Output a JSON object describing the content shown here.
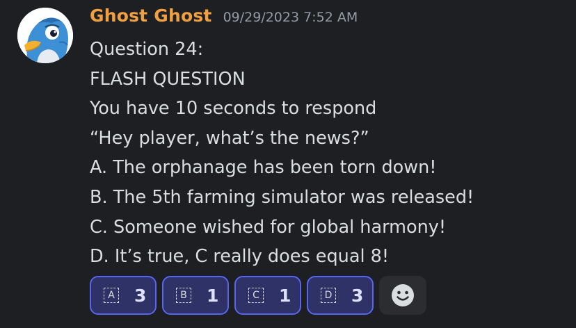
{
  "message": {
    "username": "Ghost Ghost",
    "timestamp": "09/29/2023 7:52 AM",
    "lines": [
      "Question 24:",
      "FLASH QUESTION",
      "You have 10 seconds to respond",
      "“Hey player, what’s the news?”",
      "A. The orphanage has been torn down!",
      "B. The 5th farming simulator was released!",
      "C. Someone wished for global harmony!",
      "D. It’s true, C really does equal 8!"
    ]
  },
  "reactions": [
    {
      "emoji": "A",
      "count": "3"
    },
    {
      "emoji": "B",
      "count": "1"
    },
    {
      "emoji": "C",
      "count": "1"
    },
    {
      "emoji": "D",
      "count": "3"
    }
  ],
  "colors": {
    "background": "#1e1f22",
    "username": "#f0a040",
    "timestamp": "#949ba4",
    "text": "#dbdee1",
    "reaction_border": "#5865f2",
    "reaction_bg": "#2e3266"
  },
  "icons": {
    "avatar": "blue-bird-avatar-icon",
    "add_reaction": "smiley-face-icon"
  }
}
